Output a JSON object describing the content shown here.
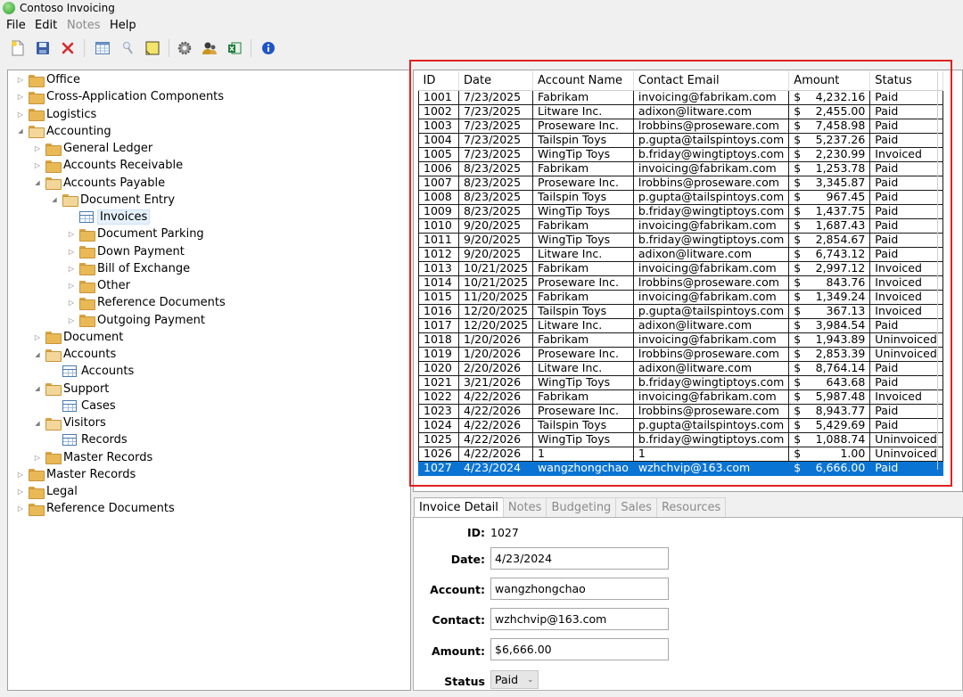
{
  "window": {
    "title": "Contoso Invoicing"
  },
  "menu": [
    {
      "label": "File",
      "disabled": false
    },
    {
      "label": "Edit",
      "disabled": false
    },
    {
      "label": "Notes",
      "disabled": true
    },
    {
      "label": "Help",
      "disabled": false
    }
  ],
  "toolbar": {
    "buttons": [
      "new-document-icon",
      "save-icon",
      "delete-icon",
      "grid-view-icon",
      "search-pin-icon",
      "note-icon",
      "settings-icon",
      "users-icon",
      "excel-icon",
      "info-icon"
    ]
  },
  "tree": [
    {
      "label": "Office",
      "level": 0,
      "expand": "collapsed",
      "icon": "folder"
    },
    {
      "label": "Cross-Application Components",
      "level": 0,
      "expand": "collapsed",
      "icon": "folder"
    },
    {
      "label": "Logistics",
      "level": 0,
      "expand": "collapsed",
      "icon": "folder"
    },
    {
      "label": "Accounting",
      "level": 0,
      "expand": "expanded",
      "icon": "folder-open"
    },
    {
      "label": "General Ledger",
      "level": 1,
      "expand": "collapsed",
      "icon": "folder"
    },
    {
      "label": "Accounts Receivable",
      "level": 1,
      "expand": "collapsed",
      "icon": "folder"
    },
    {
      "label": "Accounts Payable",
      "level": 1,
      "expand": "expanded",
      "icon": "folder-open"
    },
    {
      "label": "Document Entry",
      "level": 2,
      "expand": "expanded",
      "icon": "folder-open"
    },
    {
      "label": "Invoices",
      "level": 3,
      "expand": "none",
      "icon": "grid",
      "selected": true
    },
    {
      "label": "Document Parking",
      "level": 3,
      "expand": "collapsed",
      "icon": "folder"
    },
    {
      "label": "Down Payment",
      "level": 3,
      "expand": "collapsed",
      "icon": "folder"
    },
    {
      "label": "Bill of Exchange",
      "level": 3,
      "expand": "collapsed",
      "icon": "folder"
    },
    {
      "label": "Other",
      "level": 3,
      "expand": "collapsed",
      "icon": "folder"
    },
    {
      "label": "Reference Documents",
      "level": 3,
      "expand": "collapsed",
      "icon": "folder"
    },
    {
      "label": "Outgoing Payment",
      "level": 3,
      "expand": "collapsed",
      "icon": "folder"
    },
    {
      "label": "Document",
      "level": 1,
      "expand": "collapsed",
      "icon": "folder"
    },
    {
      "label": "Accounts",
      "level": 1,
      "expand": "expanded",
      "icon": "folder-open"
    },
    {
      "label": "Accounts",
      "level": 2,
      "expand": "none",
      "icon": "grid"
    },
    {
      "label": "Support",
      "level": 1,
      "expand": "expanded",
      "icon": "folder-open"
    },
    {
      "label": "Cases",
      "level": 2,
      "expand": "none",
      "icon": "grid"
    },
    {
      "label": "Visitors",
      "level": 1,
      "expand": "expanded",
      "icon": "folder-open"
    },
    {
      "label": "Records",
      "level": 2,
      "expand": "none",
      "icon": "grid"
    },
    {
      "label": "Master Records",
      "level": 1,
      "expand": "collapsed",
      "icon": "folder"
    },
    {
      "label": "Master Records",
      "level": 0,
      "expand": "collapsed",
      "icon": "folder"
    },
    {
      "label": "Legal",
      "level": 0,
      "expand": "collapsed",
      "icon": "folder"
    },
    {
      "label": "Reference Documents",
      "level": 0,
      "expand": "collapsed",
      "icon": "folder"
    }
  ],
  "grid": {
    "columns": [
      "ID",
      "Date",
      "Account Name",
      "Contact Email",
      "Amount",
      "Status"
    ],
    "currency_symbol": "$",
    "selected_id": "1027",
    "rows": [
      [
        "1001",
        "7/23/2025",
        "Fabrikam",
        "invoicing@fabrikam.com",
        "4,232.16",
        "Paid"
      ],
      [
        "1002",
        "7/23/2025",
        "Litware Inc.",
        "adixon@litware.com",
        "2,455.00",
        "Paid"
      ],
      [
        "1003",
        "7/23/2025",
        "Proseware Inc.",
        "lrobbins@proseware.com",
        "7,458.98",
        "Paid"
      ],
      [
        "1004",
        "7/23/2025",
        "Tailspin Toys",
        "p.gupta@tailspintoys.com",
        "5,237.26",
        "Paid"
      ],
      [
        "1005",
        "7/23/2025",
        "WingTip Toys",
        "b.friday@wingtiptoys.com",
        "2,230.99",
        "Invoiced"
      ],
      [
        "1006",
        "8/23/2025",
        "Fabrikam",
        "invoicing@fabrikam.com",
        "1,253.78",
        "Paid"
      ],
      [
        "1007",
        "8/23/2025",
        "Proseware Inc.",
        "lrobbins@proseware.com",
        "3,345.87",
        "Paid"
      ],
      [
        "1008",
        "8/23/2025",
        "Tailspin Toys",
        "p.gupta@tailspintoys.com",
        "967.45",
        "Paid"
      ],
      [
        "1009",
        "8/23/2025",
        "WingTip Toys",
        "b.friday@wingtiptoys.com",
        "1,437.75",
        "Paid"
      ],
      [
        "1010",
        "9/20/2025",
        "Fabrikam",
        "invoicing@fabrikam.com",
        "1,687.43",
        "Paid"
      ],
      [
        "1011",
        "9/20/2025",
        "WingTip Toys",
        "b.friday@wingtiptoys.com",
        "2,854.67",
        "Paid"
      ],
      [
        "1012",
        "9/20/2025",
        "Litware Inc.",
        "adixon@litware.com",
        "6,743.12",
        "Paid"
      ],
      [
        "1013",
        "10/21/2025",
        "Fabrikam",
        "invoicing@fabrikam.com",
        "2,997.12",
        "Invoiced"
      ],
      [
        "1014",
        "10/21/2025",
        "Proseware Inc.",
        "lrobbins@proseware.com",
        "843.76",
        "Invoiced"
      ],
      [
        "1015",
        "11/20/2025",
        "Fabrikam",
        "invoicing@fabrikam.com",
        "1,349.24",
        "Invoiced"
      ],
      [
        "1016",
        "12/20/2025",
        "Tailspin Toys",
        "p.gupta@tailspintoys.com",
        "367.13",
        "Invoiced"
      ],
      [
        "1017",
        "12/20/2025",
        "Litware Inc.",
        "adixon@litware.com",
        "3,984.54",
        "Paid"
      ],
      [
        "1018",
        "1/20/2026",
        "Fabrikam",
        "invoicing@fabrikam.com",
        "1,943.89",
        "Uninvoiced"
      ],
      [
        "1019",
        "1/20/2026",
        "Proseware Inc.",
        "lrobbins@proseware.com",
        "2,853.39",
        "Uninvoiced"
      ],
      [
        "1020",
        "2/20/2026",
        "Litware Inc.",
        "adixon@litware.com",
        "8,764.14",
        "Paid"
      ],
      [
        "1021",
        "3/21/2026",
        "WingTip Toys",
        "b.friday@wingtiptoys.com",
        "643.68",
        "Paid"
      ],
      [
        "1022",
        "4/22/2026",
        "Fabrikam",
        "invoicing@fabrikam.com",
        "5,987.48",
        "Invoiced"
      ],
      [
        "1023",
        "4/22/2026",
        "Proseware Inc.",
        "lrobbins@proseware.com",
        "8,943.77",
        "Paid"
      ],
      [
        "1024",
        "4/22/2026",
        "Tailspin Toys",
        "p.gupta@tailspintoys.com",
        "5,429.69",
        "Paid"
      ],
      [
        "1025",
        "4/22/2026",
        "WingTip Toys",
        "b.friday@wingtiptoys.com",
        "1,088.74",
        "Uninvoiced"
      ],
      [
        "1026",
        "4/22/2026",
        "1",
        "1",
        "1.00",
        "Uninvoiced"
      ],
      [
        "1027",
        "4/23/2024",
        "wangzhongchao",
        "wzhchvip@163.com",
        "6,666.00",
        "Paid"
      ]
    ]
  },
  "tabs": [
    {
      "label": "Invoice Detail",
      "active": true
    },
    {
      "label": "Notes",
      "active": false
    },
    {
      "label": "Budgeting",
      "active": false
    },
    {
      "label": "Sales",
      "active": false
    },
    {
      "label": "Resources",
      "active": false
    }
  ],
  "detail": {
    "id_label": "ID:",
    "id_value": "1027",
    "date_label": "Date:",
    "date_value": "4/23/2024",
    "account_label": "Account:",
    "account_value": "wangzhongchao",
    "contact_label": "Contact:",
    "contact_value": "wzhchvip@163.com",
    "amount_label": "Amount:",
    "amount_value": "$6,666.00",
    "status_label": "Status",
    "status_value": "Paid"
  },
  "colors": {
    "selection": "#0a74d4",
    "highlight_frame": "#e02020"
  }
}
